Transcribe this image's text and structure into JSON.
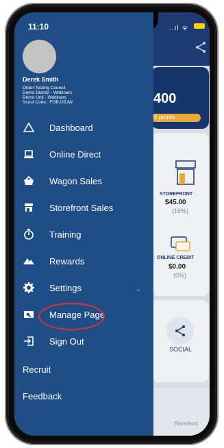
{
  "status": {
    "time": "11:10",
    "icons": "..ıl ᯤ"
  },
  "user": {
    "name": "Derek Smith",
    "details": [
      "Order Testing Council",
      "Demo District - Webinars",
      "Demo Unit - Webinars",
      "Scout Code : FOBJJSJW"
    ]
  },
  "menu": {
    "items": [
      {
        "label": "Dashboard",
        "icon": "triangle-icon"
      },
      {
        "label": "Online Direct",
        "icon": "laptop-icon"
      },
      {
        "label": "Wagon Sales",
        "icon": "basket-icon"
      },
      {
        "label": "Storefront Sales",
        "icon": "store-icon"
      },
      {
        "label": "Training",
        "icon": "stopwatch-icon"
      },
      {
        "label": "Rewards",
        "icon": "mountain-icon"
      },
      {
        "label": "Settings",
        "icon": "gear-icon"
      },
      {
        "label": "Manage Page",
        "icon": "id-card-icon"
      },
      {
        "label": "Sign Out",
        "icon": "sign-out-icon"
      }
    ],
    "plain_items": [
      "Recruit",
      "Feedback"
    ]
  },
  "background": {
    "points_value": "400",
    "points_label": "0 points",
    "storefront_label": "STOREFRONT",
    "storefront_value": "$45.00",
    "storefront_pct": "(16%)",
    "credit_label": "ONLINE CREDIT",
    "credit_value": "$0.00",
    "credit_pct": "(0%)",
    "social_label": "SOCIAL",
    "bottom_tab": "Storefront"
  },
  "colors": {
    "drawer": "#1f4e86",
    "highlight": "#e0312f",
    "accent": "#e7a93a"
  }
}
